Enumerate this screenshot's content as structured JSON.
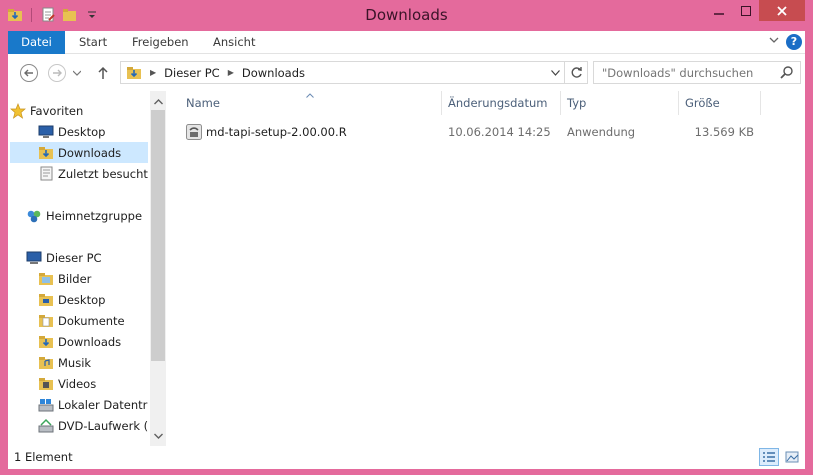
{
  "window": {
    "title": "Downloads"
  },
  "ribbon": {
    "tabs": [
      "Datei",
      "Start",
      "Freigeben",
      "Ansicht"
    ],
    "help": "?"
  },
  "address": {
    "crumbs": [
      "Dieser PC",
      "Downloads"
    ],
    "search_placeholder": "\"Downloads\" durchsuchen"
  },
  "nav": {
    "items": [
      {
        "label": "Favoriten",
        "icon": "star-icon"
      },
      {
        "label": "Desktop",
        "icon": "desktop-icon"
      },
      {
        "label": "Downloads",
        "icon": "downloads-folder-icon",
        "selected": true
      },
      {
        "label": "Zuletzt besucht",
        "icon": "recent-icon"
      },
      {
        "label": "Heimnetzgruppe",
        "icon": "homegroup-icon"
      },
      {
        "label": "Dieser PC",
        "icon": "computer-icon"
      },
      {
        "label": "Bilder",
        "icon": "folder-icon"
      },
      {
        "label": "Desktop",
        "icon": "folder-icon"
      },
      {
        "label": "Dokumente",
        "icon": "folder-icon"
      },
      {
        "label": "Downloads",
        "icon": "downloads-folder-icon"
      },
      {
        "label": "Musik",
        "icon": "folder-icon"
      },
      {
        "label": "Videos",
        "icon": "folder-icon"
      },
      {
        "label": "Lokaler Datenträg",
        "icon": "drive-icon"
      },
      {
        "label": "DVD-Laufwerk (D",
        "icon": "dvd-drive-icon"
      }
    ]
  },
  "list": {
    "columns": [
      "Name",
      "Änderungsdatum",
      "Typ",
      "Größe"
    ],
    "rows": [
      {
        "name": "md-tapi-setup-2.00.00.R",
        "date": "10.06.2014 14:25",
        "type": "Anwendung",
        "size": "13.569 KB"
      }
    ]
  },
  "status": {
    "count": "1 Element"
  },
  "colors": {
    "accent": "#1979ca",
    "frame": "#e46a9c",
    "close": "#c74c50",
    "selection": "#cde8ff"
  }
}
